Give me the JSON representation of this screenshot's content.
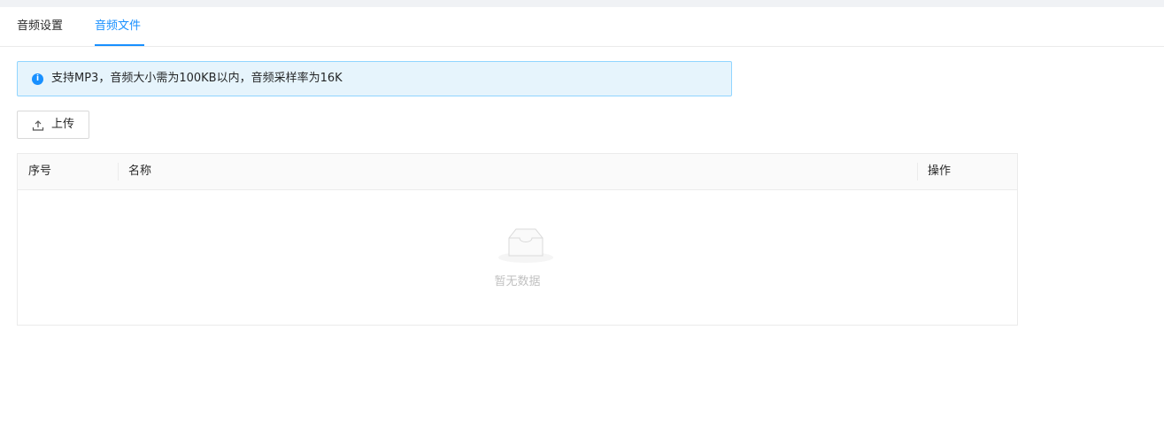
{
  "tabs": [
    {
      "label": "音频设置",
      "active": false
    },
    {
      "label": "音频文件",
      "active": true
    }
  ],
  "alert": {
    "icon": "info-icon",
    "text": "支持MP3，音频大小需为100KB以内，音频采样率为16K"
  },
  "toolbar": {
    "upload_label": "上传",
    "upload_icon": "upload-icon"
  },
  "table": {
    "columns": [
      "序号",
      "名称",
      "操作"
    ],
    "rows": [],
    "empty_text": "暂无数据",
    "empty_icon": "inbox-icon"
  },
  "colors": {
    "accent": "#1890ff",
    "alert_bg": "#e6f4fc",
    "alert_border": "#91d5ff"
  }
}
